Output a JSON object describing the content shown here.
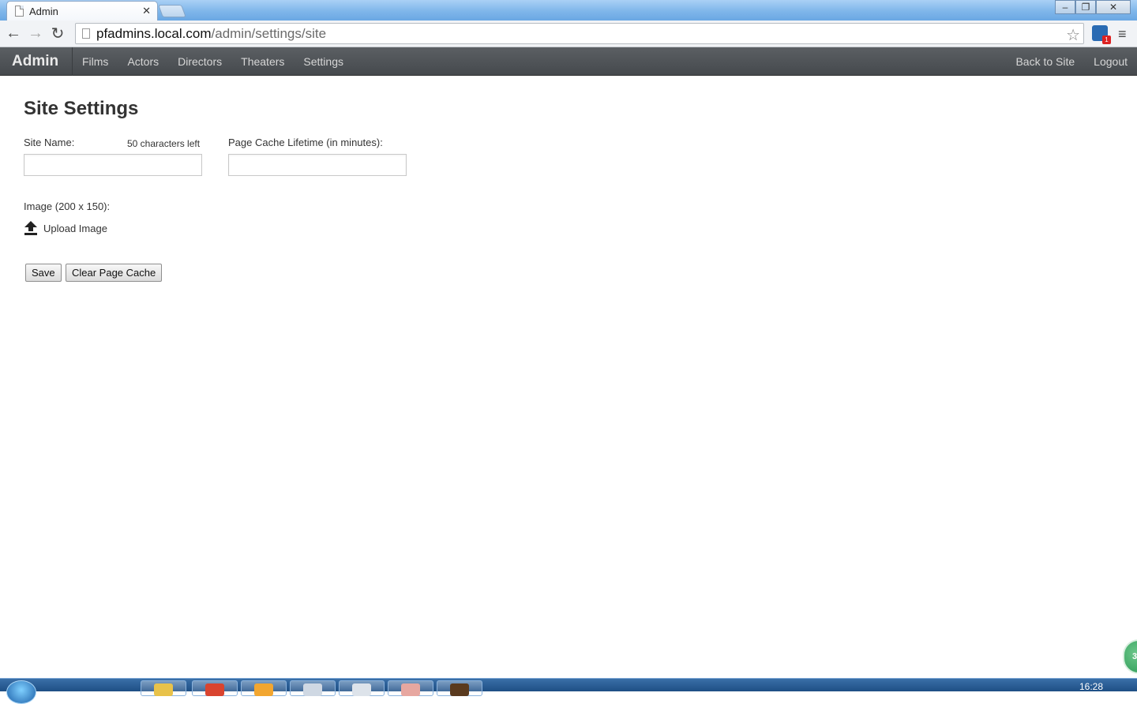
{
  "browser": {
    "tab_title": "Admin",
    "url_host": "pfadmins.local.com",
    "url_path": "/admin/settings/site"
  },
  "navbar": {
    "brand": "Admin",
    "left_links": [
      "Films",
      "Actors",
      "Directors",
      "Theaters",
      "Settings"
    ],
    "right_links": [
      "Back to Site",
      "Logout"
    ]
  },
  "page": {
    "title": "Site Settings",
    "site_name_label": "Site Name:",
    "site_name_counter": "50 characters left",
    "site_name_value": "",
    "cache_lifetime_label": "Page Cache Lifetime (in minutes):",
    "cache_lifetime_value": "",
    "image_label": "Image (200 x 150):",
    "upload_label": "Upload Image",
    "save_button": "Save",
    "clear_cache_button": "Clear Page Cache"
  },
  "taskbar": {
    "clock": "16:28",
    "badge": "38"
  },
  "colors": {
    "navbar": "#4f5357",
    "nav_text": "#d6d6d6",
    "heading": "#333333"
  }
}
